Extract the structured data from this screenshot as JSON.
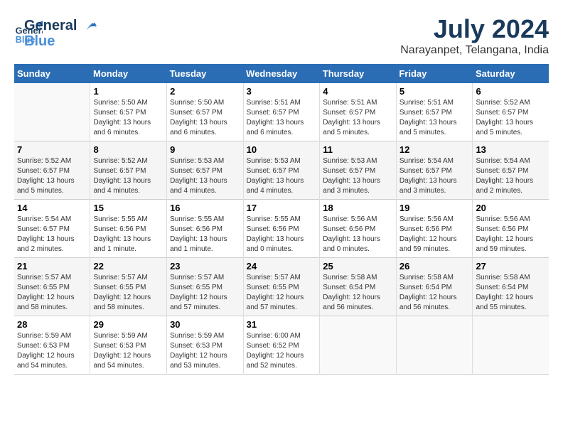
{
  "header": {
    "logo_general": "General",
    "logo_blue": "Blue",
    "title": "July 2024",
    "subtitle": "Narayanpet, Telangana, India"
  },
  "days_of_week": [
    "Sunday",
    "Monday",
    "Tuesday",
    "Wednesday",
    "Thursday",
    "Friday",
    "Saturday"
  ],
  "weeks": [
    {
      "days": [
        {
          "num": "",
          "info": ""
        },
        {
          "num": "1",
          "info": "Sunrise: 5:50 AM\nSunset: 6:57 PM\nDaylight: 13 hours\nand 6 minutes."
        },
        {
          "num": "2",
          "info": "Sunrise: 5:50 AM\nSunset: 6:57 PM\nDaylight: 13 hours\nand 6 minutes."
        },
        {
          "num": "3",
          "info": "Sunrise: 5:51 AM\nSunset: 6:57 PM\nDaylight: 13 hours\nand 6 minutes."
        },
        {
          "num": "4",
          "info": "Sunrise: 5:51 AM\nSunset: 6:57 PM\nDaylight: 13 hours\nand 5 minutes."
        },
        {
          "num": "5",
          "info": "Sunrise: 5:51 AM\nSunset: 6:57 PM\nDaylight: 13 hours\nand 5 minutes."
        },
        {
          "num": "6",
          "info": "Sunrise: 5:52 AM\nSunset: 6:57 PM\nDaylight: 13 hours\nand 5 minutes."
        }
      ]
    },
    {
      "days": [
        {
          "num": "7",
          "info": "Sunrise: 5:52 AM\nSunset: 6:57 PM\nDaylight: 13 hours\nand 5 minutes."
        },
        {
          "num": "8",
          "info": "Sunrise: 5:52 AM\nSunset: 6:57 PM\nDaylight: 13 hours\nand 4 minutes."
        },
        {
          "num": "9",
          "info": "Sunrise: 5:53 AM\nSunset: 6:57 PM\nDaylight: 13 hours\nand 4 minutes."
        },
        {
          "num": "10",
          "info": "Sunrise: 5:53 AM\nSunset: 6:57 PM\nDaylight: 13 hours\nand 4 minutes."
        },
        {
          "num": "11",
          "info": "Sunrise: 5:53 AM\nSunset: 6:57 PM\nDaylight: 13 hours\nand 3 minutes."
        },
        {
          "num": "12",
          "info": "Sunrise: 5:54 AM\nSunset: 6:57 PM\nDaylight: 13 hours\nand 3 minutes."
        },
        {
          "num": "13",
          "info": "Sunrise: 5:54 AM\nSunset: 6:57 PM\nDaylight: 13 hours\nand 2 minutes."
        }
      ]
    },
    {
      "days": [
        {
          "num": "14",
          "info": "Sunrise: 5:54 AM\nSunset: 6:57 PM\nDaylight: 13 hours\nand 2 minutes."
        },
        {
          "num": "15",
          "info": "Sunrise: 5:55 AM\nSunset: 6:56 PM\nDaylight: 13 hours\nand 1 minute."
        },
        {
          "num": "16",
          "info": "Sunrise: 5:55 AM\nSunset: 6:56 PM\nDaylight: 13 hours\nand 1 minute."
        },
        {
          "num": "17",
          "info": "Sunrise: 5:55 AM\nSunset: 6:56 PM\nDaylight: 13 hours\nand 0 minutes."
        },
        {
          "num": "18",
          "info": "Sunrise: 5:56 AM\nSunset: 6:56 PM\nDaylight: 13 hours\nand 0 minutes."
        },
        {
          "num": "19",
          "info": "Sunrise: 5:56 AM\nSunset: 6:56 PM\nDaylight: 12 hours\nand 59 minutes."
        },
        {
          "num": "20",
          "info": "Sunrise: 5:56 AM\nSunset: 6:56 PM\nDaylight: 12 hours\nand 59 minutes."
        }
      ]
    },
    {
      "days": [
        {
          "num": "21",
          "info": "Sunrise: 5:57 AM\nSunset: 6:55 PM\nDaylight: 12 hours\nand 58 minutes."
        },
        {
          "num": "22",
          "info": "Sunrise: 5:57 AM\nSunset: 6:55 PM\nDaylight: 12 hours\nand 58 minutes."
        },
        {
          "num": "23",
          "info": "Sunrise: 5:57 AM\nSunset: 6:55 PM\nDaylight: 12 hours\nand 57 minutes."
        },
        {
          "num": "24",
          "info": "Sunrise: 5:57 AM\nSunset: 6:55 PM\nDaylight: 12 hours\nand 57 minutes."
        },
        {
          "num": "25",
          "info": "Sunrise: 5:58 AM\nSunset: 6:54 PM\nDaylight: 12 hours\nand 56 minutes."
        },
        {
          "num": "26",
          "info": "Sunrise: 5:58 AM\nSunset: 6:54 PM\nDaylight: 12 hours\nand 56 minutes."
        },
        {
          "num": "27",
          "info": "Sunrise: 5:58 AM\nSunset: 6:54 PM\nDaylight: 12 hours\nand 55 minutes."
        }
      ]
    },
    {
      "days": [
        {
          "num": "28",
          "info": "Sunrise: 5:59 AM\nSunset: 6:53 PM\nDaylight: 12 hours\nand 54 minutes."
        },
        {
          "num": "29",
          "info": "Sunrise: 5:59 AM\nSunset: 6:53 PM\nDaylight: 12 hours\nand 54 minutes."
        },
        {
          "num": "30",
          "info": "Sunrise: 5:59 AM\nSunset: 6:53 PM\nDaylight: 12 hours\nand 53 minutes."
        },
        {
          "num": "31",
          "info": "Sunrise: 6:00 AM\nSunset: 6:52 PM\nDaylight: 12 hours\nand 52 minutes."
        },
        {
          "num": "",
          "info": ""
        },
        {
          "num": "",
          "info": ""
        },
        {
          "num": "",
          "info": ""
        }
      ]
    }
  ]
}
